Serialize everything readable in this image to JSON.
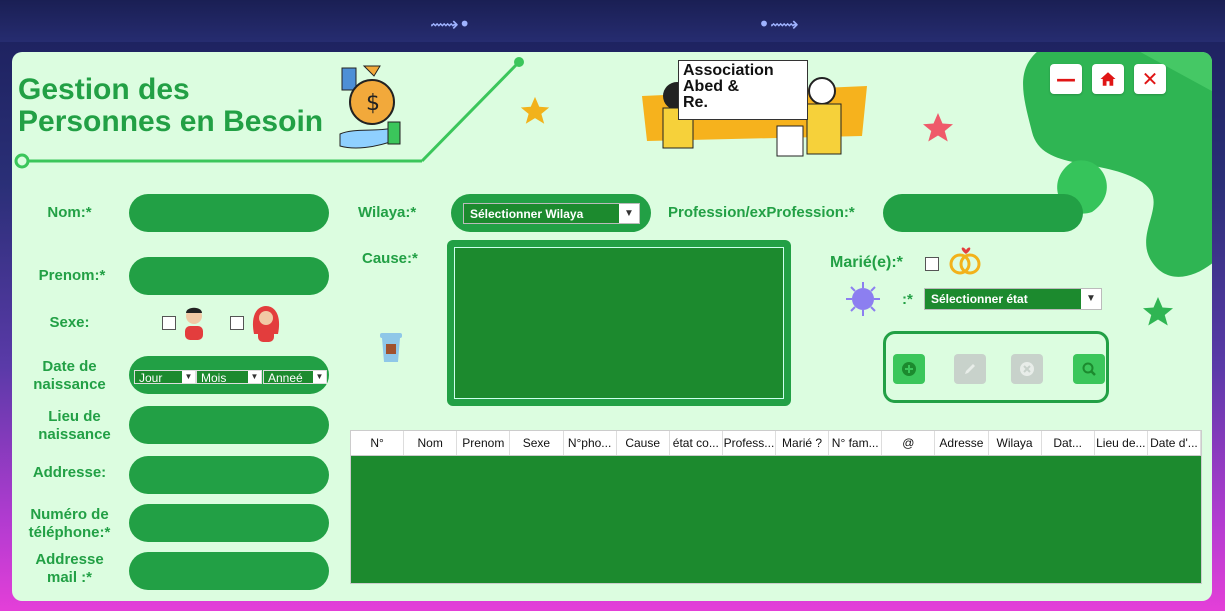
{
  "app": {
    "title_line1": "Gestion des",
    "title_line2": "Personnes en Besoin"
  },
  "logo": {
    "line1": "Association",
    "line2": "Abed &",
    "line3": "Re."
  },
  "window_controls": {
    "minimize": "—",
    "home": "home-icon",
    "close": "✕"
  },
  "form": {
    "nom_label": "Nom:*",
    "prenom_label": "Prenom:*",
    "sexe_label": "Sexe:",
    "date_label_1": "Date de",
    "date_label_2": "naissance",
    "date_day": "Jour",
    "date_month": "Mois",
    "date_year": "Anneé",
    "lieu_label_1": "Lieu de",
    "lieu_label_2": "naissance",
    "addresse_label": "Addresse:",
    "tel_label_1": "Numéro de",
    "tel_label_2": "téléphone:*",
    "mail_label_1": "Addresse",
    "mail_label_2": "mail :*",
    "wilaya_label": "Wilaya:*",
    "wilaya_select": "Sélectionner Wilaya",
    "profession_label": "Profession/exProfession:*",
    "cause_label": "Cause:*",
    "marie_label": "Marié(e):*",
    "etat_label": ":*",
    "etat_select": "Sélectionner état"
  },
  "table": {
    "columns": [
      "N°",
      "Nom",
      "Prenom",
      "Sexe",
      "N°pho...",
      "Cause",
      "état co...",
      "Profess...",
      "Marié ?",
      "N° fam...",
      "@",
      "Adresse",
      "Wilaya",
      "Dat...",
      "Lieu de...",
      "Date d'..."
    ],
    "rows": []
  },
  "colors": {
    "accent": "#22a045",
    "panel": "#dcfde0",
    "dark_green": "#1c8a2e",
    "danger": "#e01515"
  }
}
